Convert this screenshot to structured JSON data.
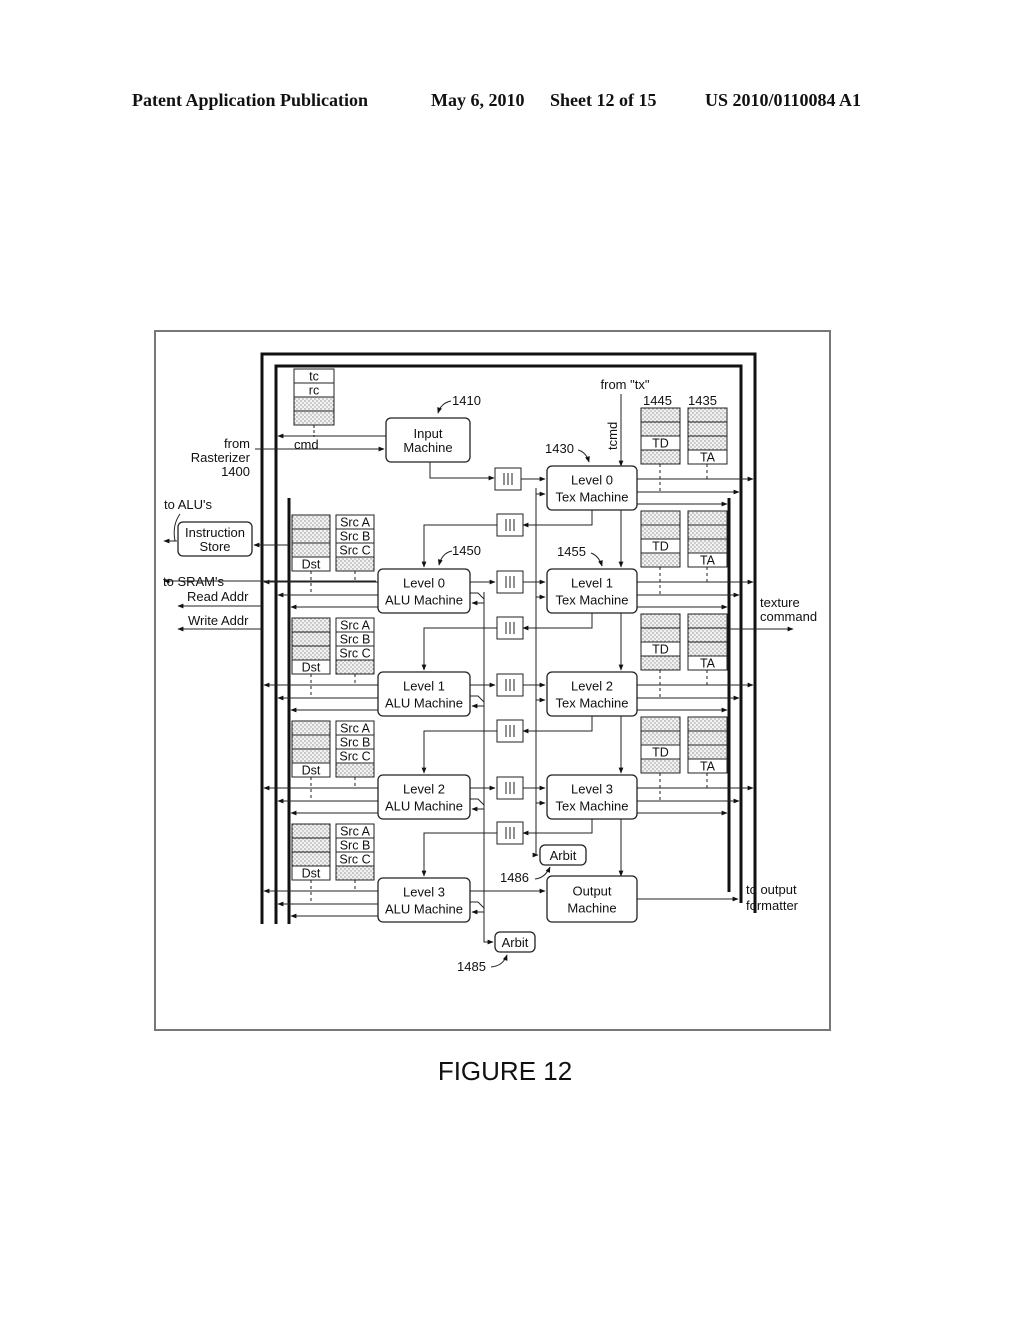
{
  "header": {
    "publication": "Patent Application Publication",
    "date": "May 6, 2010",
    "sheet": "Sheet 12 of 15",
    "number": "US 2010/0110084 A1"
  },
  "figure_caption": "FIGURE 12",
  "labels": {
    "from_rasterizer": [
      "from",
      "Rasterizer",
      "1400"
    ],
    "cmd": "cmd",
    "tc": "tc",
    "rc": "rc",
    "ref_1410": "1410",
    "ref_1430": "1430",
    "ref_1445": "1445",
    "ref_1435": "1435",
    "ref_1450": "1450",
    "ref_1455": "1455",
    "ref_1486": "1486",
    "ref_1485": "1485",
    "from_tx": "from \"tx\"",
    "tcmd": "tcmd",
    "to_alus": "to ALU's",
    "to_srams": "to SRAM's",
    "read_addr": "Read Addr",
    "write_addr": "Write Addr",
    "texture_command": [
      "texture",
      "command"
    ],
    "to_output_formatter": [
      "to output",
      "formatter"
    ],
    "td": "TD",
    "ta": "TA",
    "src_a": "Src A",
    "src_b": "Src B",
    "src_c": "Src C",
    "dst": "Dst",
    "fifo": "|||"
  },
  "blocks": {
    "input_machine": [
      "Input",
      "Machine"
    ],
    "instruction_store": [
      "Instruction",
      "Store"
    ],
    "output_machine": [
      "Output",
      "Machine"
    ],
    "arbit": "Arbit",
    "tex_machines": [
      [
        "Level 0",
        "Tex Machine"
      ],
      [
        "Level 1",
        "Tex Machine"
      ],
      [
        "Level 2",
        "Tex Machine"
      ],
      [
        "Level 3",
        "Tex Machine"
      ]
    ],
    "alu_machines": [
      [
        "Level 0",
        "ALU Machine"
      ],
      [
        "Level 1",
        "ALU Machine"
      ],
      [
        "Level 2",
        "ALU Machine"
      ],
      [
        "Level 3",
        "ALU Machine"
      ]
    ]
  }
}
